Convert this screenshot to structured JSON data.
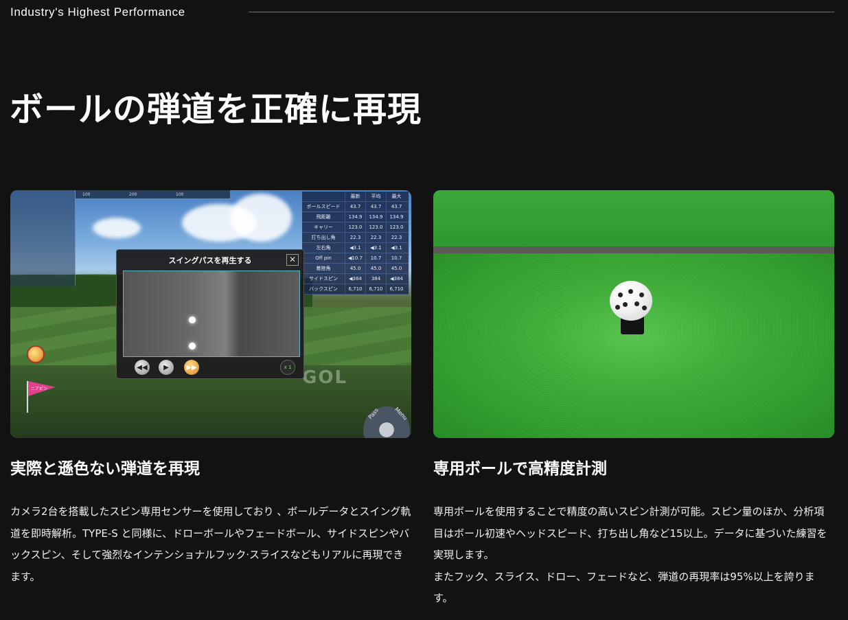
{
  "header": {
    "eyebrow": "Industry's Highest Performance"
  },
  "headline": "ボールの弾道を正確に再現",
  "cards": [
    {
      "title": "実際と遜色ない弾道を再現",
      "body": "カメラ2台を搭載したスピン専用センサーを使用しており 、ボールデータとスイング軌道を即時解析。TYPE-S と同様に、ドローボールやフェードボール、サイドスピンやバックスピン、そして強烈なインテンショナルフック·スライスなどもリアルに再現できます。",
      "image": {
        "popup_title": "スイングパスを再生する",
        "speed_label": "x 1",
        "watermark": "GOL",
        "flag_label": "ニアピン",
        "dial_left": "Pass",
        "dial_right": "Menu",
        "ruler": [
          "100",
          "200",
          "100"
        ],
        "stats_headers": [
          "最新",
          "平均",
          "最大"
        ],
        "stats_rows": [
          {
            "label": "ボールスピード",
            "v": [
              "43.7",
              "43.7",
              "43.7"
            ]
          },
          {
            "label": "飛距離",
            "v": [
              "134.9",
              "134.9",
              "134.9"
            ]
          },
          {
            "label": "キャリー",
            "v": [
              "123.0",
              "123.0",
              "123.0"
            ]
          },
          {
            "label": "打ち出し角",
            "v": [
              "22.3",
              "22.3",
              "22.3"
            ]
          },
          {
            "label": "左右角",
            "v": [
              "◀3.1",
              "◀3.1",
              "◀3.1"
            ]
          },
          {
            "label": "Off pin",
            "v": [
              "◀10.7",
              "10.7",
              "10.7"
            ]
          },
          {
            "label": "着陸角",
            "v": [
              "45.0",
              "45.0",
              "45.0"
            ]
          },
          {
            "label": "サイドスピン",
            "v": [
              "◀384",
              "384",
              "◀384"
            ]
          },
          {
            "label": "バックスピン",
            "v": [
              "6,710",
              "6,710",
              "6,710"
            ]
          }
        ]
      }
    },
    {
      "title": "専用ボールで高精度計測",
      "body_lines": [
        "専用ボールを使用することで精度の高いスピン計測が可能。スピン量のほか、分析項目はボール初速やヘッドスピード、打ち出し角など15以上。データに基づいた練習を実現します。",
        "またフック、スライス、ドロー、フェードなど、弾道の再現率は95%以上を誇ります。"
      ]
    }
  ],
  "colors": {
    "background": "#121212",
    "text": "#ffffff",
    "rule": "#777777",
    "turf_green": "#3eab37"
  }
}
